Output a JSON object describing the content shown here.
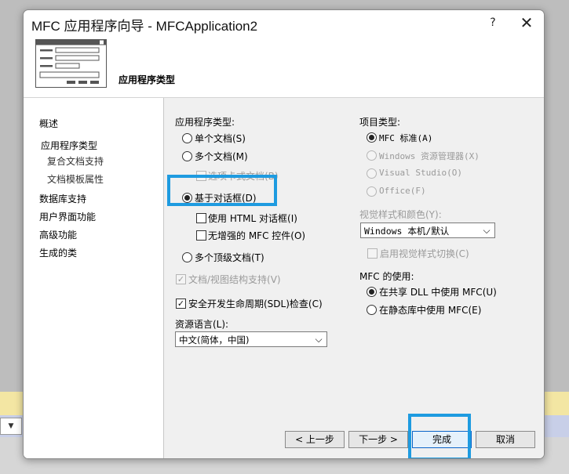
{
  "dialog": {
    "title": "MFC 应用程序向导 - MFCApplication2",
    "help_label": "?",
    "close_label": "✕",
    "banner_title": "应用程序类型"
  },
  "nav": {
    "items": [
      "概述",
      "应用程序类型",
      "复合文档支持",
      "文档模板属性",
      "数据库支持",
      "用户界面功能",
      "高级功能",
      "生成的类"
    ],
    "selected": "应用程序类型"
  },
  "left_panel": {
    "app_type_label": "应用程序类型:",
    "radios": [
      "单个文档(S)",
      "多个文档(M)",
      "基于对话框(D)",
      "多个顶级文档(T)"
    ],
    "selected_radio": "基于对话框(D)",
    "tabbed_docs_label": "选项卡式文档(B)",
    "html_dialog_label": "使用 HTML 对话框(I)",
    "no_mfc_controls_label": "无增强的 MFC 控件(O)",
    "doc_view_label": "文档/视图结构支持(V)",
    "sdl_label": "安全开发生命周期(SDL)检查(C)",
    "sdl_checked": true,
    "resource_lang_label": "资源语言(L):",
    "resource_lang_value": "中文(简体，中国)"
  },
  "right_panel": {
    "project_type_label": "项目类型:",
    "project_radios": [
      "MFC 标准(A)",
      "Windows 资源管理器(X)",
      "Visual Studio(O)",
      "Office(F)"
    ],
    "selected_project": "MFC 标准(A)",
    "visual_style_label": "视觉样式和颜色(Y):",
    "visual_style_value": "Windows 本机/默认",
    "enable_switch_label": "启用视觉样式切换(C)",
    "mfc_use_label": "MFC 的使用:",
    "mfc_radios": [
      "在共享 DLL 中使用 MFC(U)",
      "在静态库中使用 MFC(E)"
    ],
    "selected_mfc": "在共享 DLL 中使用 MFC(U)"
  },
  "buttons": {
    "prev": "< 上一步",
    "next": "下一步 >",
    "finish": "完成",
    "cancel": "取消"
  },
  "colors": {
    "highlight": "#1e9be0",
    "dialog_bg": "#f0f0f0",
    "backdrop_yellow": "#f3e6a3"
  }
}
